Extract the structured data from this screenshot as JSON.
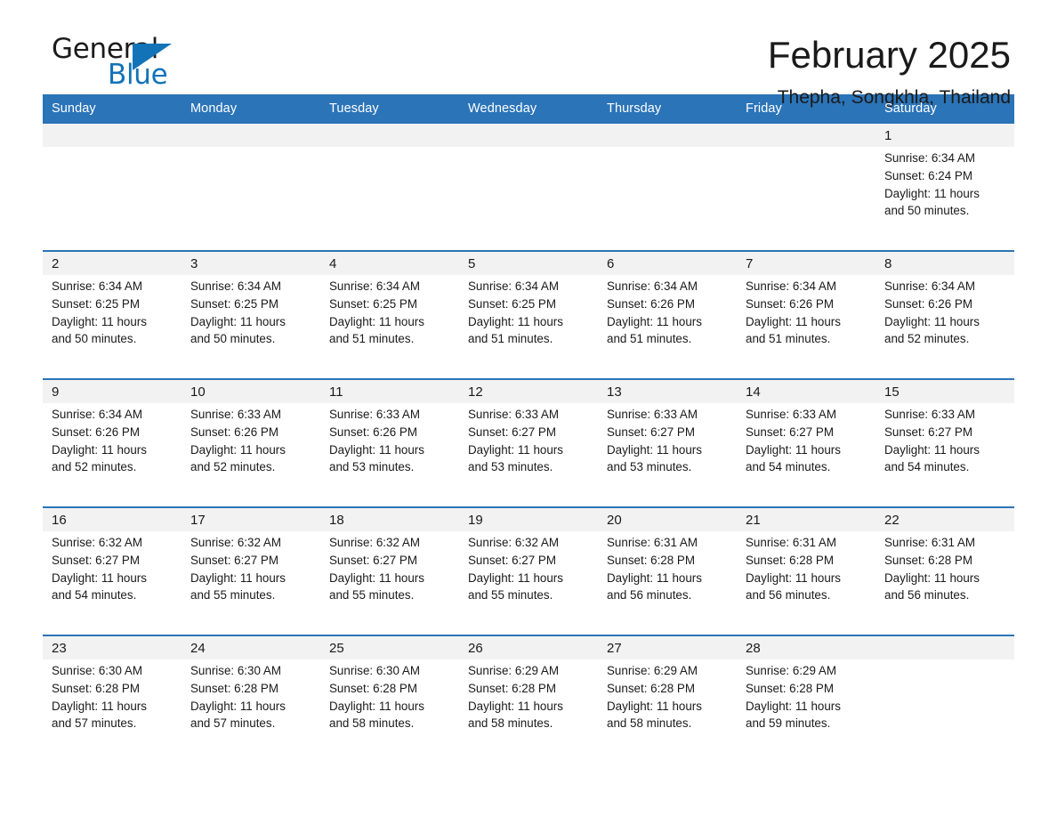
{
  "logo": {
    "word_one": "General",
    "word_two": "Blue",
    "triangle_color": "#1273b8"
  },
  "header": {
    "title": "February 2025",
    "subtitle": "Thepha, Songkhla, Thailand"
  },
  "theme": {
    "header_blue": "#2b74b8",
    "daynum_gray": "#f2f2f2",
    "text": "#1a1a1a"
  },
  "weekday_headers": [
    "Sunday",
    "Monday",
    "Tuesday",
    "Wednesday",
    "Thursday",
    "Friday",
    "Saturday"
  ],
  "weeks": [
    {
      "days": [
        {
          "date": "",
          "sunrise": "",
          "sunset": "",
          "daylight_1": "",
          "daylight_2": ""
        },
        {
          "date": "",
          "sunrise": "",
          "sunset": "",
          "daylight_1": "",
          "daylight_2": ""
        },
        {
          "date": "",
          "sunrise": "",
          "sunset": "",
          "daylight_1": "",
          "daylight_2": ""
        },
        {
          "date": "",
          "sunrise": "",
          "sunset": "",
          "daylight_1": "",
          "daylight_2": ""
        },
        {
          "date": "",
          "sunrise": "",
          "sunset": "",
          "daylight_1": "",
          "daylight_2": ""
        },
        {
          "date": "",
          "sunrise": "",
          "sunset": "",
          "daylight_1": "",
          "daylight_2": ""
        },
        {
          "date": "1",
          "sunrise": "Sunrise: 6:34 AM",
          "sunset": "Sunset: 6:24 PM",
          "daylight_1": "Daylight: 11 hours",
          "daylight_2": "and 50 minutes."
        }
      ]
    },
    {
      "days": [
        {
          "date": "2",
          "sunrise": "Sunrise: 6:34 AM",
          "sunset": "Sunset: 6:25 PM",
          "daylight_1": "Daylight: 11 hours",
          "daylight_2": "and 50 minutes."
        },
        {
          "date": "3",
          "sunrise": "Sunrise: 6:34 AM",
          "sunset": "Sunset: 6:25 PM",
          "daylight_1": "Daylight: 11 hours",
          "daylight_2": "and 50 minutes."
        },
        {
          "date": "4",
          "sunrise": "Sunrise: 6:34 AM",
          "sunset": "Sunset: 6:25 PM",
          "daylight_1": "Daylight: 11 hours",
          "daylight_2": "and 51 minutes."
        },
        {
          "date": "5",
          "sunrise": "Sunrise: 6:34 AM",
          "sunset": "Sunset: 6:25 PM",
          "daylight_1": "Daylight: 11 hours",
          "daylight_2": "and 51 minutes."
        },
        {
          "date": "6",
          "sunrise": "Sunrise: 6:34 AM",
          "sunset": "Sunset: 6:26 PM",
          "daylight_1": "Daylight: 11 hours",
          "daylight_2": "and 51 minutes."
        },
        {
          "date": "7",
          "sunrise": "Sunrise: 6:34 AM",
          "sunset": "Sunset: 6:26 PM",
          "daylight_1": "Daylight: 11 hours",
          "daylight_2": "and 51 minutes."
        },
        {
          "date": "8",
          "sunrise": "Sunrise: 6:34 AM",
          "sunset": "Sunset: 6:26 PM",
          "daylight_1": "Daylight: 11 hours",
          "daylight_2": "and 52 minutes."
        }
      ]
    },
    {
      "days": [
        {
          "date": "9",
          "sunrise": "Sunrise: 6:34 AM",
          "sunset": "Sunset: 6:26 PM",
          "daylight_1": "Daylight: 11 hours",
          "daylight_2": "and 52 minutes."
        },
        {
          "date": "10",
          "sunrise": "Sunrise: 6:33 AM",
          "sunset": "Sunset: 6:26 PM",
          "daylight_1": "Daylight: 11 hours",
          "daylight_2": "and 52 minutes."
        },
        {
          "date": "11",
          "sunrise": "Sunrise: 6:33 AM",
          "sunset": "Sunset: 6:26 PM",
          "daylight_1": "Daylight: 11 hours",
          "daylight_2": "and 53 minutes."
        },
        {
          "date": "12",
          "sunrise": "Sunrise: 6:33 AM",
          "sunset": "Sunset: 6:27 PM",
          "daylight_1": "Daylight: 11 hours",
          "daylight_2": "and 53 minutes."
        },
        {
          "date": "13",
          "sunrise": "Sunrise: 6:33 AM",
          "sunset": "Sunset: 6:27 PM",
          "daylight_1": "Daylight: 11 hours",
          "daylight_2": "and 53 minutes."
        },
        {
          "date": "14",
          "sunrise": "Sunrise: 6:33 AM",
          "sunset": "Sunset: 6:27 PM",
          "daylight_1": "Daylight: 11 hours",
          "daylight_2": "and 54 minutes."
        },
        {
          "date": "15",
          "sunrise": "Sunrise: 6:33 AM",
          "sunset": "Sunset: 6:27 PM",
          "daylight_1": "Daylight: 11 hours",
          "daylight_2": "and 54 minutes."
        }
      ]
    },
    {
      "days": [
        {
          "date": "16",
          "sunrise": "Sunrise: 6:32 AM",
          "sunset": "Sunset: 6:27 PM",
          "daylight_1": "Daylight: 11 hours",
          "daylight_2": "and 54 minutes."
        },
        {
          "date": "17",
          "sunrise": "Sunrise: 6:32 AM",
          "sunset": "Sunset: 6:27 PM",
          "daylight_1": "Daylight: 11 hours",
          "daylight_2": "and 55 minutes."
        },
        {
          "date": "18",
          "sunrise": "Sunrise: 6:32 AM",
          "sunset": "Sunset: 6:27 PM",
          "daylight_1": "Daylight: 11 hours",
          "daylight_2": "and 55 minutes."
        },
        {
          "date": "19",
          "sunrise": "Sunrise: 6:32 AM",
          "sunset": "Sunset: 6:27 PM",
          "daylight_1": "Daylight: 11 hours",
          "daylight_2": "and 55 minutes."
        },
        {
          "date": "20",
          "sunrise": "Sunrise: 6:31 AM",
          "sunset": "Sunset: 6:28 PM",
          "daylight_1": "Daylight: 11 hours",
          "daylight_2": "and 56 minutes."
        },
        {
          "date": "21",
          "sunrise": "Sunrise: 6:31 AM",
          "sunset": "Sunset: 6:28 PM",
          "daylight_1": "Daylight: 11 hours",
          "daylight_2": "and 56 minutes."
        },
        {
          "date": "22",
          "sunrise": "Sunrise: 6:31 AM",
          "sunset": "Sunset: 6:28 PM",
          "daylight_1": "Daylight: 11 hours",
          "daylight_2": "and 56 minutes."
        }
      ]
    },
    {
      "days": [
        {
          "date": "23",
          "sunrise": "Sunrise: 6:30 AM",
          "sunset": "Sunset: 6:28 PM",
          "daylight_1": "Daylight: 11 hours",
          "daylight_2": "and 57 minutes."
        },
        {
          "date": "24",
          "sunrise": "Sunrise: 6:30 AM",
          "sunset": "Sunset: 6:28 PM",
          "daylight_1": "Daylight: 11 hours",
          "daylight_2": "and 57 minutes."
        },
        {
          "date": "25",
          "sunrise": "Sunrise: 6:30 AM",
          "sunset": "Sunset: 6:28 PM",
          "daylight_1": "Daylight: 11 hours",
          "daylight_2": "and 58 minutes."
        },
        {
          "date": "26",
          "sunrise": "Sunrise: 6:29 AM",
          "sunset": "Sunset: 6:28 PM",
          "daylight_1": "Daylight: 11 hours",
          "daylight_2": "and 58 minutes."
        },
        {
          "date": "27",
          "sunrise": "Sunrise: 6:29 AM",
          "sunset": "Sunset: 6:28 PM",
          "daylight_1": "Daylight: 11 hours",
          "daylight_2": "and 58 minutes."
        },
        {
          "date": "28",
          "sunrise": "Sunrise: 6:29 AM",
          "sunset": "Sunset: 6:28 PM",
          "daylight_1": "Daylight: 11 hours",
          "daylight_2": "and 59 minutes."
        },
        {
          "date": "",
          "sunrise": "",
          "sunset": "",
          "daylight_1": "",
          "daylight_2": ""
        }
      ]
    }
  ]
}
